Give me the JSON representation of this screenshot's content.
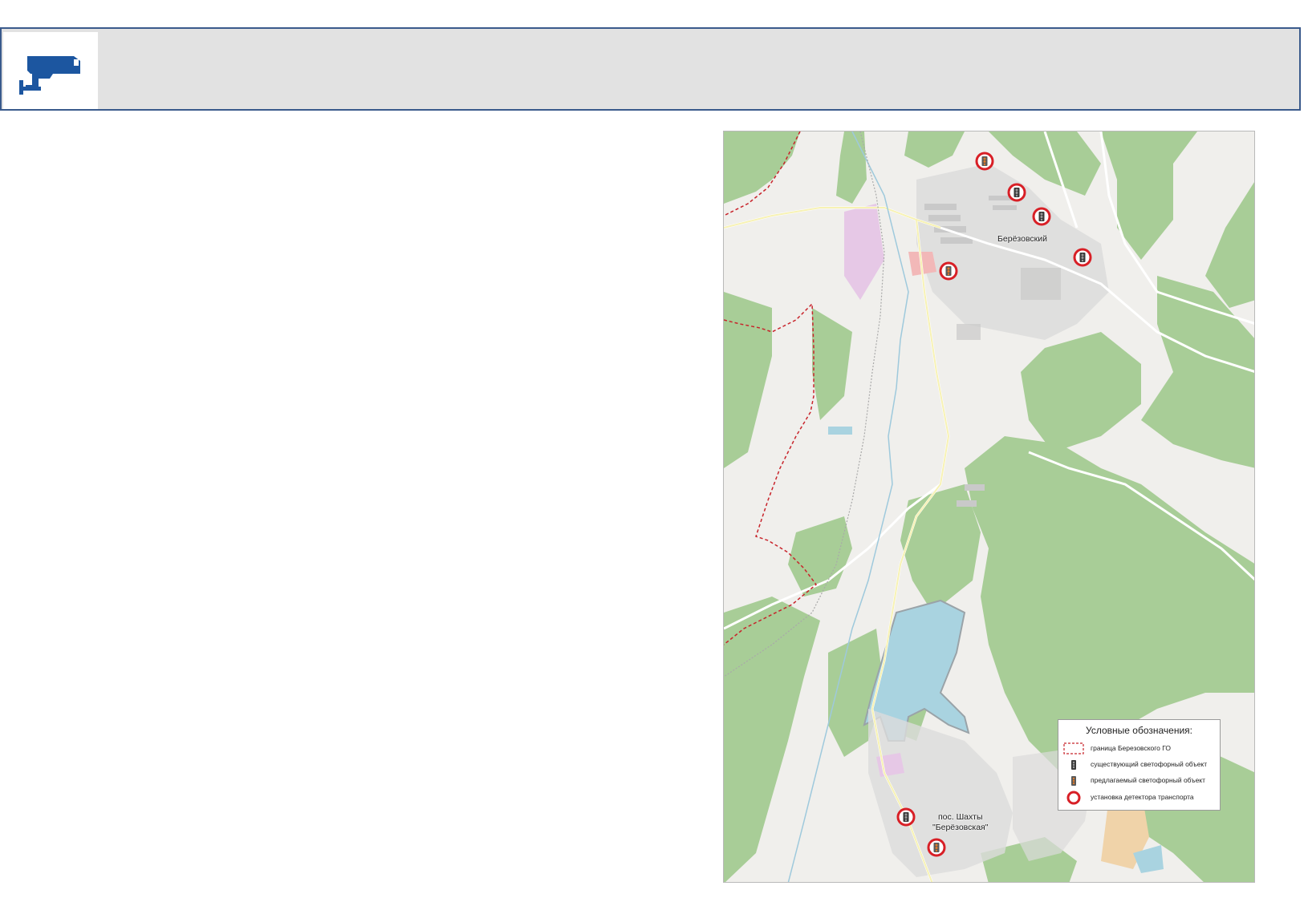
{
  "header": {
    "title": "",
    "icon": "surveillance-camera-icon",
    "bar_color": "#e2e2e2",
    "border_color": "#3a5a8c",
    "icon_color": "#1c56a0"
  },
  "map": {
    "places": [
      {
        "id": "berezovsky",
        "label": "Берёзовский"
      },
      {
        "id": "shakhty",
        "label": "пос. Шахты\n\"Берёзовская\""
      }
    ],
    "legend": {
      "title": "Условные обозначения:",
      "items": [
        {
          "symbol": "boundary-dashed-line",
          "label": "граница Березовского ГО"
        },
        {
          "symbol": "traffic-light-existing-icon",
          "label": "существующий светофорный объект"
        },
        {
          "symbol": "traffic-light-proposed-icon",
          "label": "предлагаемый светофорный объект"
        },
        {
          "symbol": "detector-ring-icon",
          "label": "установка детектора транспорта"
        }
      ]
    },
    "colors": {
      "forest": "#a8cd97",
      "land": "#f0efec",
      "water": "#a9d3e0",
      "boundary": "#c8242b",
      "detector": "#d81f26",
      "residential": "#dcdcdc",
      "industrial": "#e6c8e6",
      "sand": "#f0d3a9"
    }
  }
}
